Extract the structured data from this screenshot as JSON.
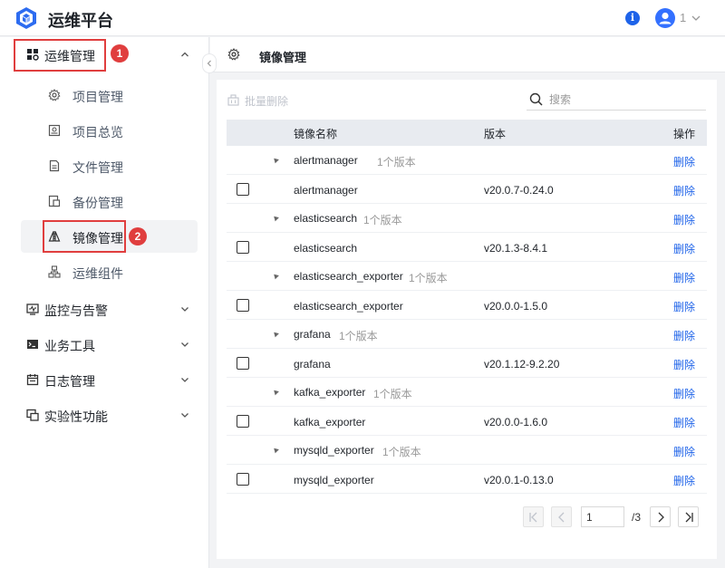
{
  "header": {
    "app_title": "运维平台",
    "info_label": "i",
    "user_count": "1"
  },
  "sidebar": {
    "groups": [
      {
        "label": "运维管理",
        "icon": "apps-icon",
        "expanded": true,
        "callout": "1"
      },
      {
        "label": "监控与告警",
        "icon": "monitor-icon",
        "expanded": false
      },
      {
        "label": "业务工具",
        "icon": "terminal-icon",
        "expanded": false
      },
      {
        "label": "日志管理",
        "icon": "calendar-icon",
        "expanded": false
      },
      {
        "label": "实验性功能",
        "icon": "lab-icon",
        "expanded": false
      }
    ],
    "items": [
      {
        "label": "项目管理",
        "icon": "gear-icon"
      },
      {
        "label": "项目总览",
        "icon": "overview-icon"
      },
      {
        "label": "文件管理",
        "icon": "file-icon"
      },
      {
        "label": "备份管理",
        "icon": "backup-icon"
      },
      {
        "label": "镜像管理",
        "icon": "mirror-icon",
        "active": true,
        "callout": "2"
      },
      {
        "label": "运维组件",
        "icon": "components-icon"
      }
    ]
  },
  "page": {
    "title": "镜像管理"
  },
  "toolbar": {
    "batch_delete": "批量删除",
    "search_placeholder": "搜索"
  },
  "table": {
    "columns": [
      "镜像名称",
      "版本",
      "操作"
    ],
    "delete_label": "删除",
    "groups": [
      {
        "name": "alertmanager",
        "count": "1个版本",
        "image": "alertmanager",
        "version": "v20.0.7-0.24.0"
      },
      {
        "name": "elasticsearch",
        "count": "1个版本",
        "image": "elasticsearch",
        "version": "v20.1.3-8.4.1"
      },
      {
        "name": "elasticsearch_exporter",
        "count": "1个版本",
        "image": "elasticsearch_exporter",
        "version": "v20.0.0-1.5.0"
      },
      {
        "name": "grafana",
        "count": "1个版本",
        "image": "grafana",
        "version": "v20.1.12-9.2.20"
      },
      {
        "name": "kafka_exporter",
        "count": "1个版本",
        "image": "kafka_exporter",
        "version": "v20.0.0-1.6.0"
      },
      {
        "name": "mysqld_exporter",
        "count": "1个版本",
        "image": "mysqld_exporter",
        "version": "v20.0.1-0.13.0"
      }
    ]
  },
  "pagination": {
    "current_page": "1",
    "total_label": "/3"
  },
  "colors": {
    "accent": "#1e63e9",
    "callout": "#e03e3e"
  }
}
